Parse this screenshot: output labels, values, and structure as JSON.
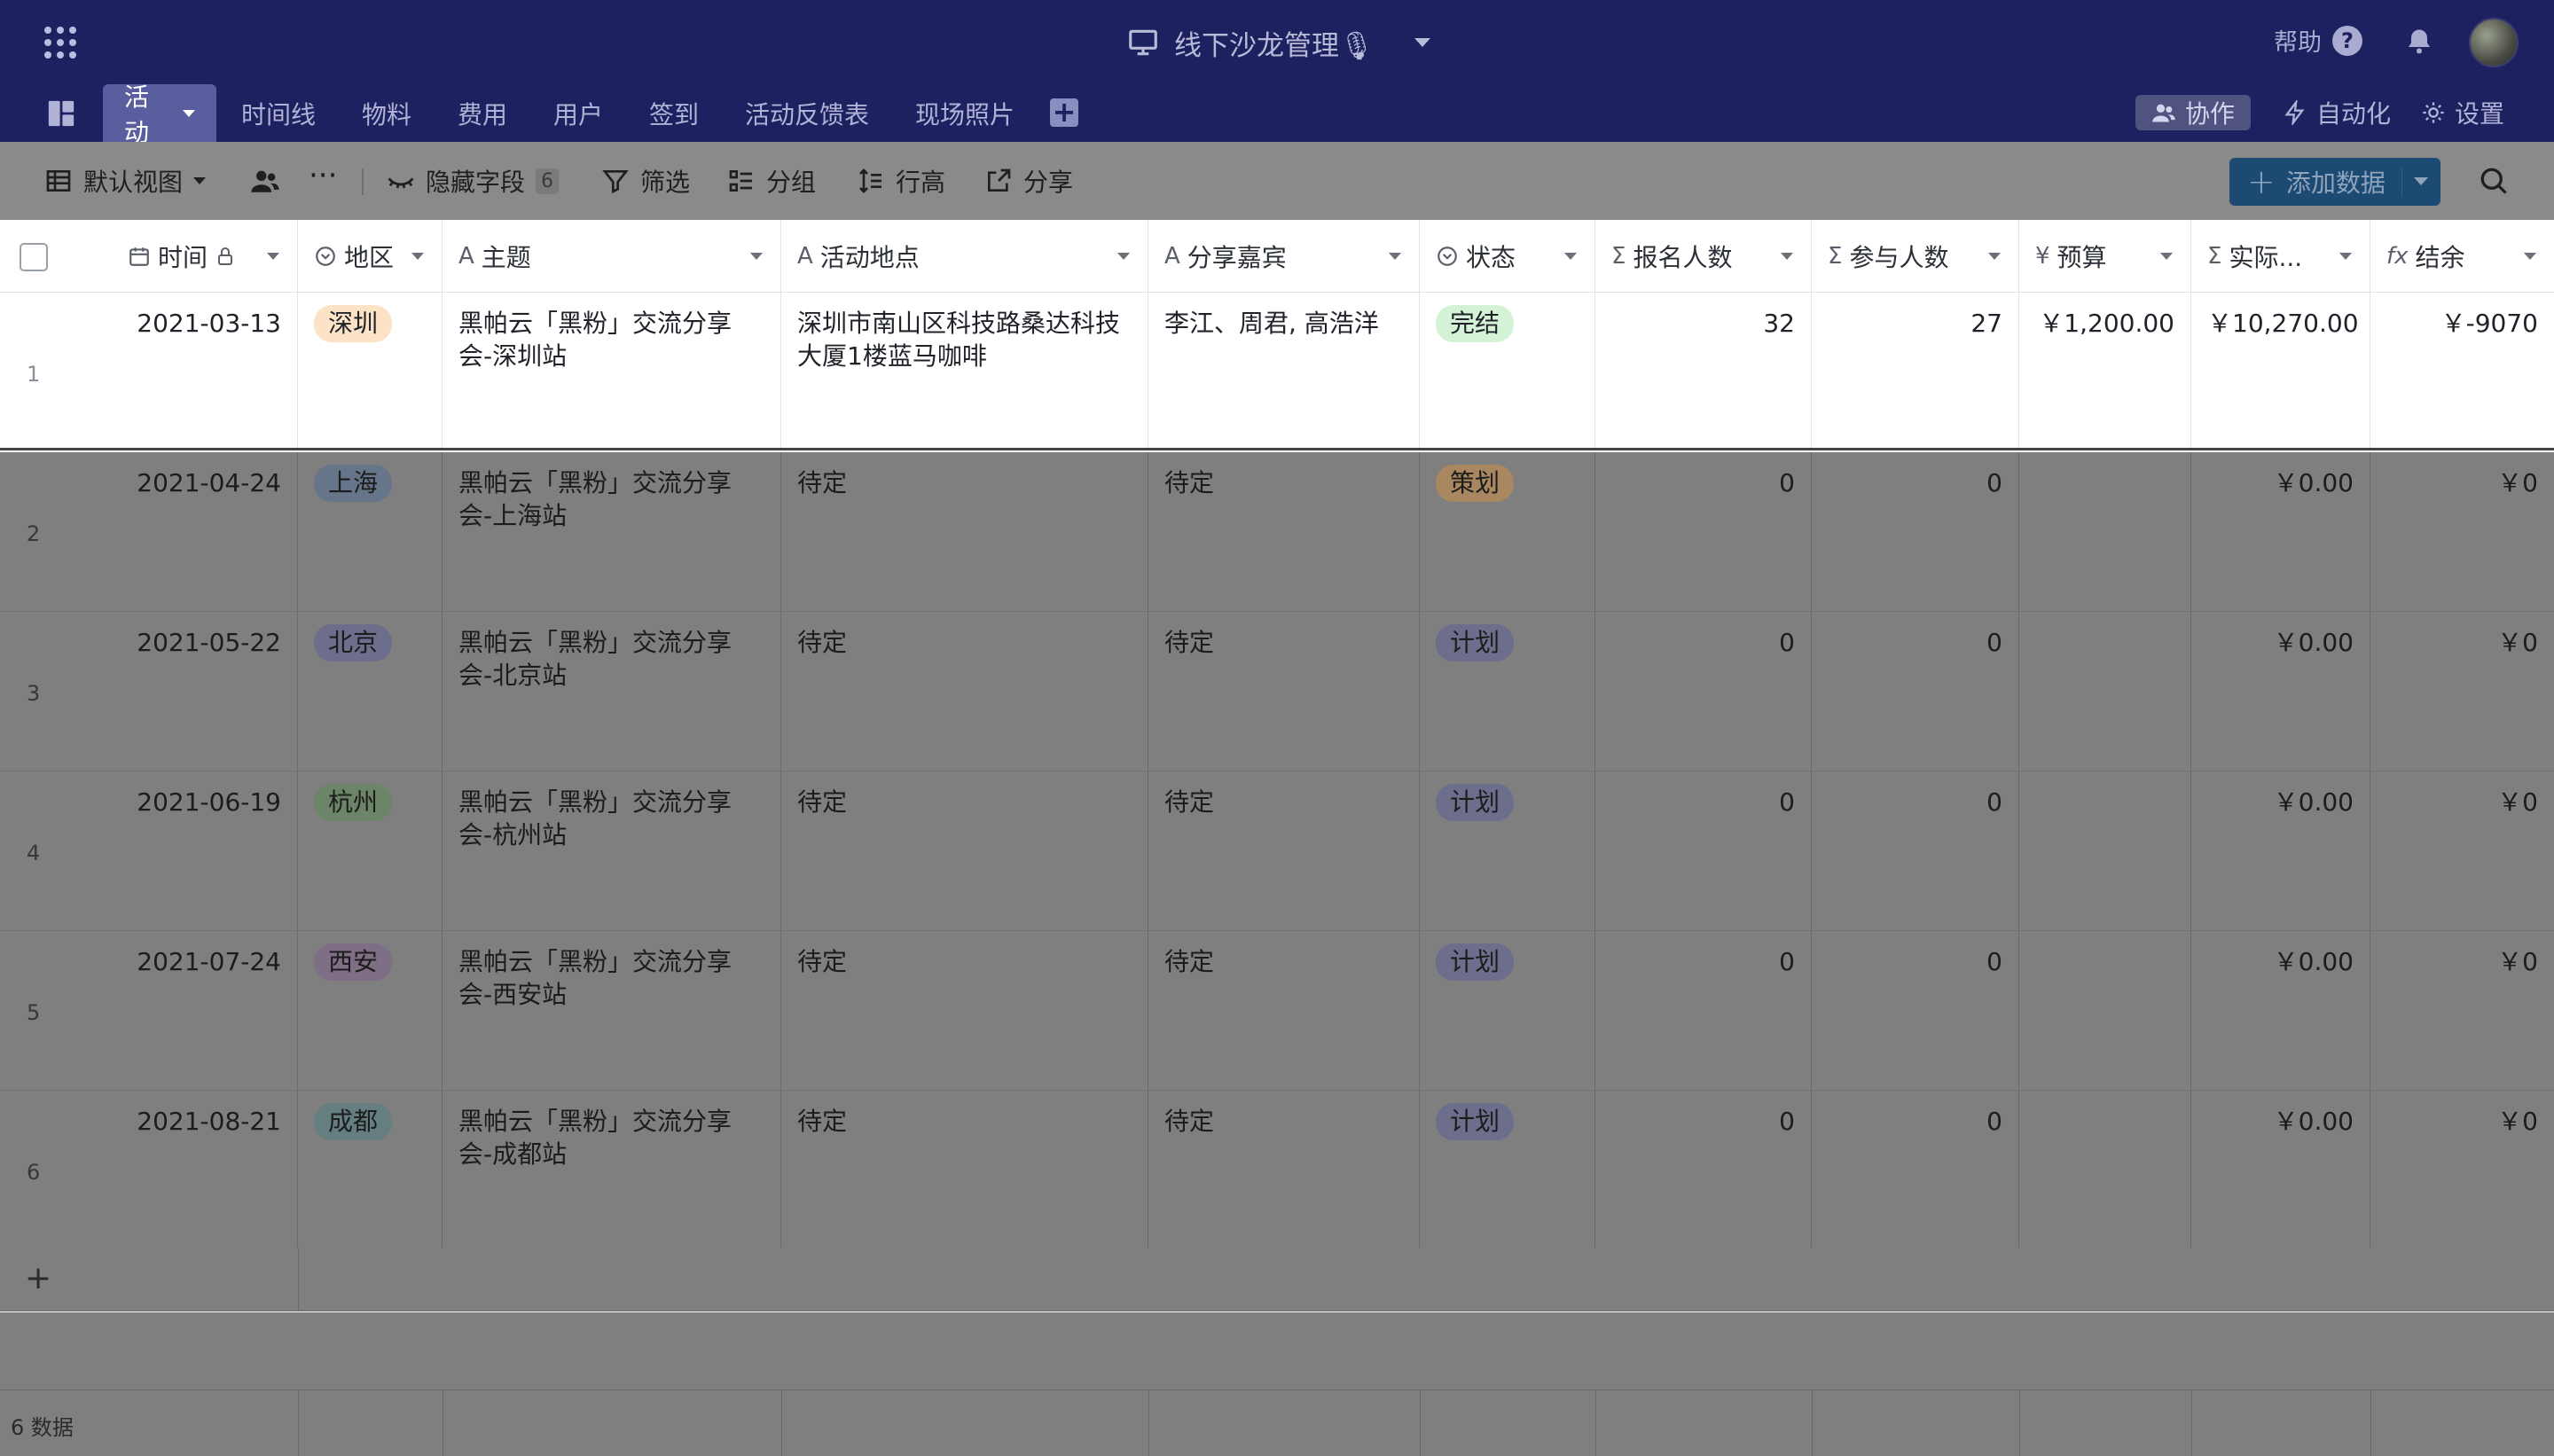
{
  "header": {
    "title": "线下沙龙管理🎙",
    "help_label": "帮助",
    "tabs": [
      {
        "label": "活动",
        "active": true
      },
      {
        "label": "时间线"
      },
      {
        "label": "物料"
      },
      {
        "label": "费用"
      },
      {
        "label": "用户"
      },
      {
        "label": "签到"
      },
      {
        "label": "活动反馈表"
      },
      {
        "label": "现场照片"
      }
    ],
    "collab_label": "协作",
    "automation_label": "自动化",
    "settings_label": "设置",
    "colors": {
      "bg": "#1e2160",
      "active_tab": "#5a5d9e"
    }
  },
  "toolbar": {
    "view_label": "默认视图",
    "hidden_fields_label": "隐藏字段",
    "hidden_fields_count": "6",
    "filter_label": "筛选",
    "group_label": "分组",
    "row_height_label": "行高",
    "share_label": "分享",
    "add_data_label": "添加数据"
  },
  "columns": [
    {
      "label": "时间",
      "icon": "calendar-icon"
    },
    {
      "label": "地区",
      "icon": "select-icon"
    },
    {
      "label": "主题",
      "icon": "text-icon"
    },
    {
      "label": "活动地点",
      "icon": "text-icon"
    },
    {
      "label": "分享嘉宾",
      "icon": "text-icon"
    },
    {
      "label": "状态",
      "icon": "select-icon"
    },
    {
      "label": "报名人数",
      "icon": "sum-icon"
    },
    {
      "label": "参与人数",
      "icon": "sum-icon"
    },
    {
      "label": "预算",
      "icon": "currency-icon"
    },
    {
      "label": "实际...",
      "icon": "sum-icon"
    },
    {
      "label": "结余",
      "icon": "formula-icon"
    }
  ],
  "rows": [
    {
      "num": "1",
      "date": "2021-03-13",
      "region": "深圳",
      "topic": "黑帕云「黑粉」交流分享会-深圳站",
      "place": "深圳市南山区科技路桑达科技大厦1楼蓝马咖啡",
      "guests": "李江、周君, 高浩洋",
      "status": "完结",
      "signup": "32",
      "attend": "27",
      "budget": "￥1,200.00",
      "actual": "￥10,270.00",
      "balance": "￥-9070"
    },
    {
      "num": "2",
      "date": "2021-04-24",
      "region": "上海",
      "topic": "黑帕云「黑粉」交流分享会-上海站",
      "place": "待定",
      "guests": "待定",
      "status": "策划",
      "signup": "0",
      "attend": "0",
      "budget": "",
      "actual": "￥0.00",
      "balance": "￥0"
    },
    {
      "num": "3",
      "date": "2021-05-22",
      "region": "北京",
      "topic": "黑帕云「黑粉」交流分享会-北京站",
      "place": "待定",
      "guests": "待定",
      "status": "计划",
      "signup": "0",
      "attend": "0",
      "budget": "",
      "actual": "￥0.00",
      "balance": "￥0"
    },
    {
      "num": "4",
      "date": "2021-06-19",
      "region": "杭州",
      "topic": "黑帕云「黑粉」交流分享会-杭州站",
      "place": "待定",
      "guests": "待定",
      "status": "计划",
      "signup": "0",
      "attend": "0",
      "budget": "",
      "actual": "￥0.00",
      "balance": "￥0"
    },
    {
      "num": "5",
      "date": "2021-07-24",
      "region": "西安",
      "topic": "黑帕云「黑粉」交流分享会-西安站",
      "place": "待定",
      "guests": "待定",
      "status": "计划",
      "signup": "0",
      "attend": "0",
      "budget": "",
      "actual": "￥0.00",
      "balance": "￥0"
    },
    {
      "num": "6",
      "date": "2021-08-21",
      "region": "成都",
      "topic": "黑帕云「黑粉」交流分享会-成都站",
      "place": "待定",
      "guests": "待定",
      "status": "计划",
      "signup": "0",
      "attend": "0",
      "budget": "",
      "actual": "￥0.00",
      "balance": "￥0"
    }
  ],
  "region_colors": {
    "深圳": "#fde3c6",
    "上海": "#67758a",
    "北京": "#6c6e8c",
    "杭州": "#6c8467",
    "西安": "#7e6e86",
    "成都": "#657e80"
  },
  "status_colors": {
    "完结": "#d4f2d6",
    "策划": "#a98760",
    "计划": "#6c6e8c"
  },
  "footer": {
    "count_label": "6 数据"
  }
}
